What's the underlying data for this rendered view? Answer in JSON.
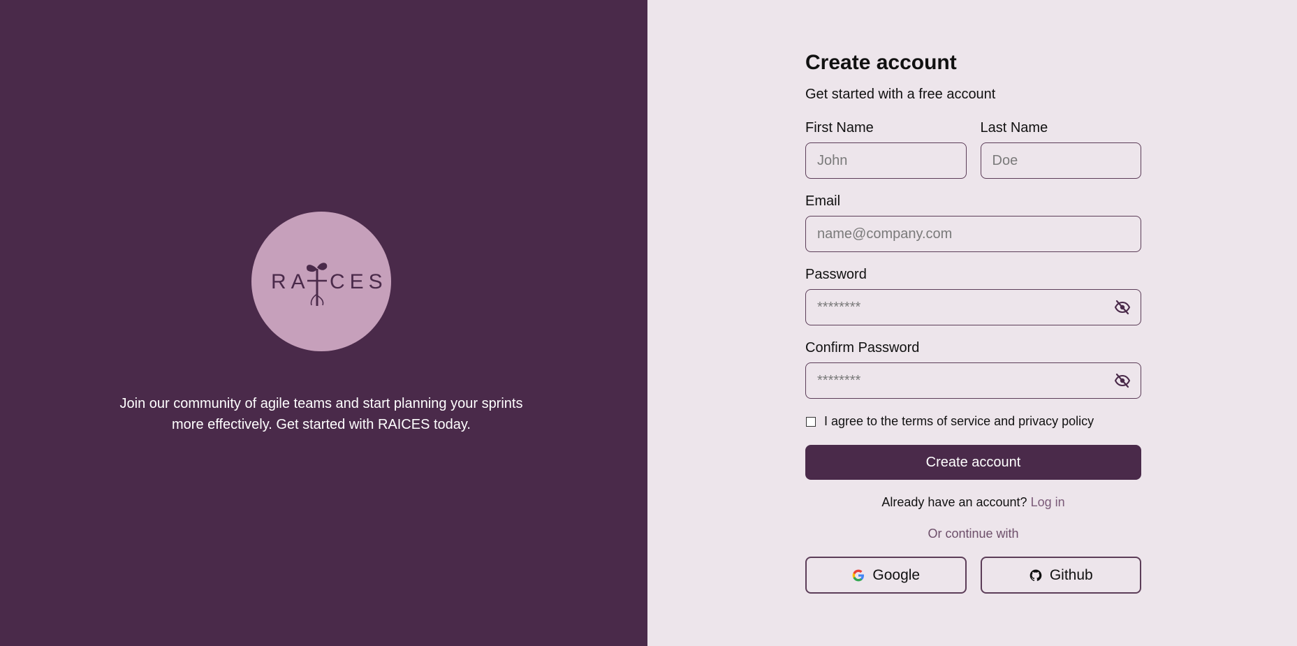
{
  "brand": {
    "logo_text": "RAICES",
    "tagline": "Join our community of agile teams and start planning your sprints more effectively. Get started with RAICES today.",
    "colors": {
      "primary": "#4a2a4a",
      "logo_circle": "#c6a0bb",
      "background": "#ede5eb",
      "link": "#7a5a78"
    }
  },
  "form": {
    "title": "Create account",
    "subtitle": "Get started with a free account",
    "first_name": {
      "label": "First Name",
      "placeholder": "John"
    },
    "last_name": {
      "label": "Last Name",
      "placeholder": "Doe"
    },
    "email": {
      "label": "Email",
      "placeholder": "name@company.com"
    },
    "password": {
      "label": "Password",
      "placeholder": "********",
      "icon": "eye-off-icon"
    },
    "confirm_password": {
      "label": "Confirm Password",
      "placeholder": "********",
      "icon": "eye-off-icon"
    },
    "agree": {
      "label": "I agree to the terms of service and privacy policy",
      "checked": false
    },
    "submit_label": "Create account",
    "login_prompt": "Already have an account?",
    "login_link": "Log in",
    "or_continue": "Or continue with",
    "social": {
      "google": {
        "label": "Google",
        "icon": "google-icon"
      },
      "github": {
        "label": "Github",
        "icon": "github-icon"
      }
    }
  }
}
